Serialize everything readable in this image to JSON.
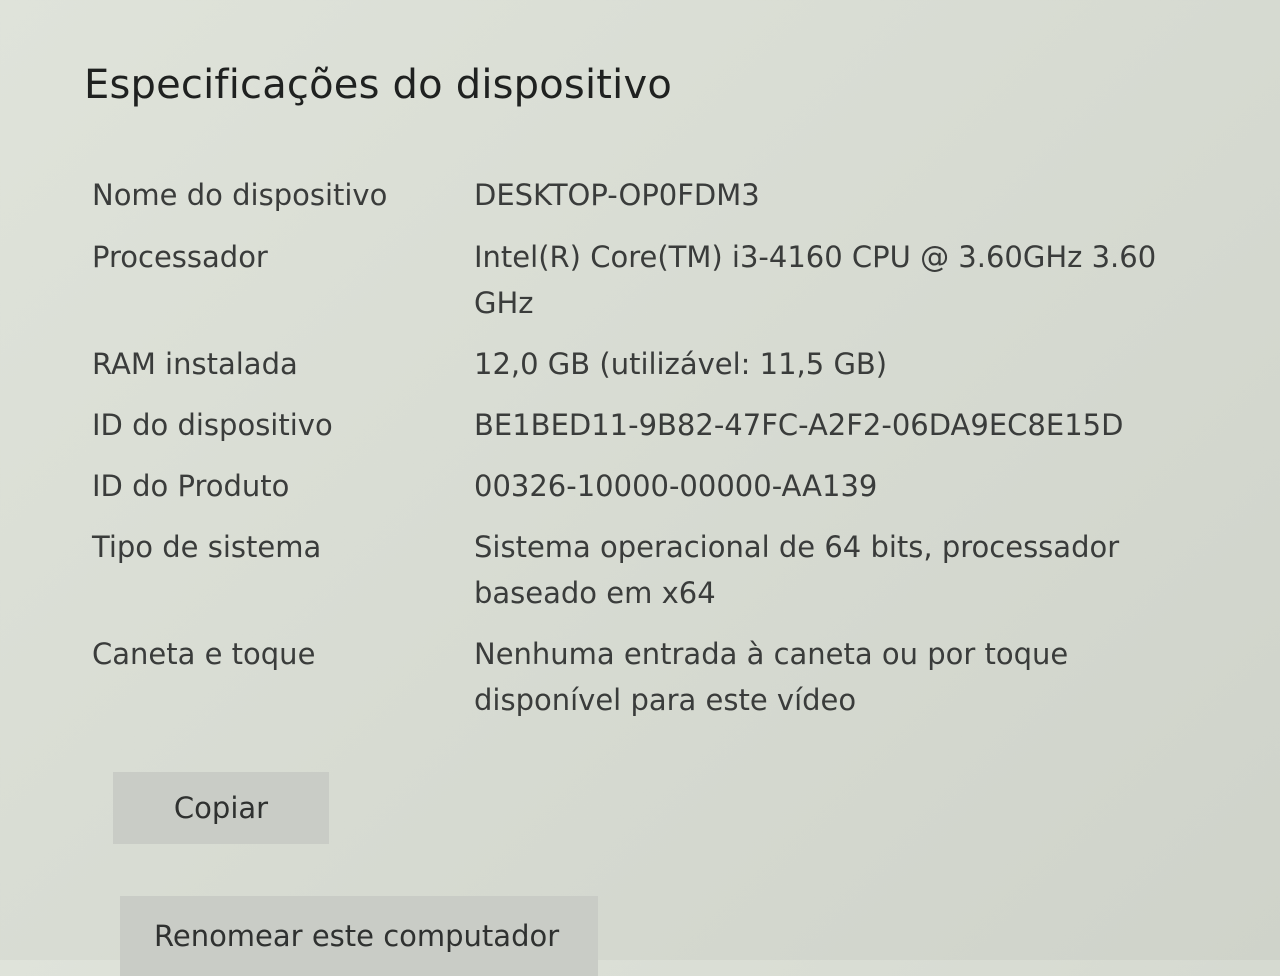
{
  "section": {
    "title": "Especificações do dispositivo"
  },
  "specs": [
    {
      "label": "Nome do dispositivo",
      "value": "DESKTOP-OP0FDM3"
    },
    {
      "label": "Processador",
      "value": "Intel(R) Core(TM) i3-4160 CPU @ 3.60GHz   3.60 GHz"
    },
    {
      "label": "RAM instalada",
      "value": "12,0 GB (utilizável: 11,5 GB)"
    },
    {
      "label": "ID do dispositivo",
      "value": "BE1BED11-9B82-47FC-A2F2-06DA9EC8E15D"
    },
    {
      "label": "ID do Produto",
      "value": "00326-10000-00000-AA139"
    },
    {
      "label": "Tipo de sistema",
      "value": "Sistema operacional de 64 bits, processador baseado em x64"
    },
    {
      "label": "Caneta e toque",
      "value": "Nenhuma entrada à caneta ou por toque disponível para este vídeo"
    }
  ],
  "buttons": {
    "copy_label": "Copiar",
    "rename_label": "Renomear este computador"
  }
}
